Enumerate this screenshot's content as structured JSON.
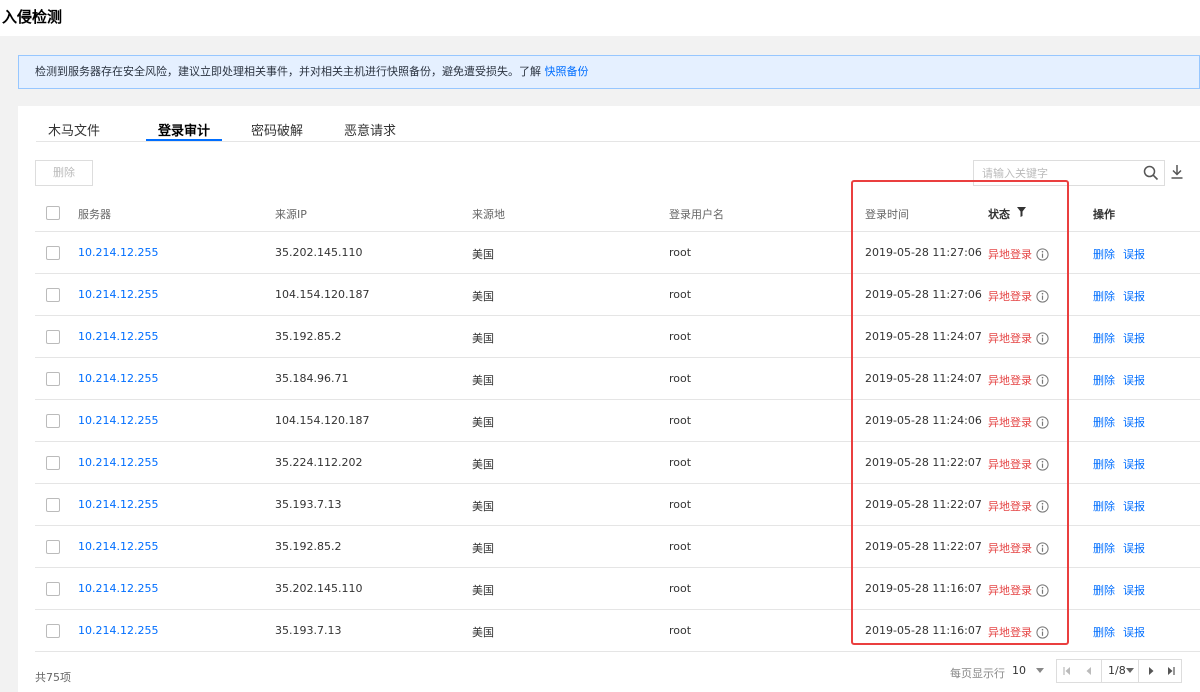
{
  "page": {
    "title": "入侵检测"
  },
  "notice": {
    "text": "检测到服务器存在安全风险，建议立即处理相关事件，并对相关主机进行快照备份，避免遭受损失。了解 ",
    "link": "快照备份"
  },
  "tabs": [
    {
      "label": "木马文件",
      "active": false
    },
    {
      "label": "登录审计",
      "active": true
    },
    {
      "label": "密码破解",
      "active": false
    },
    {
      "label": "恶意请求",
      "active": false
    }
  ],
  "toolbar": {
    "delete_label": "删除",
    "search_placeholder": "请输入关键字"
  },
  "table": {
    "columns": {
      "server": "服务器",
      "source_ip": "来源IP",
      "source_location": "来源地",
      "login_user": "登录用户名",
      "login_time": "登录时间",
      "status": "状态",
      "actions": "操作"
    },
    "rows": [
      {
        "server": "10.214.12.255",
        "ip": "35.202.145.110",
        "location": "美国",
        "user": "root",
        "time": "2019-05-28 11:27:06",
        "status": "异地登录",
        "delete": "删除",
        "report": "误报"
      },
      {
        "server": "10.214.12.255",
        "ip": "104.154.120.187",
        "location": "美国",
        "user": "root",
        "time": "2019-05-28 11:27:06",
        "status": "异地登录",
        "delete": "删除",
        "report": "误报"
      },
      {
        "server": "10.214.12.255",
        "ip": "35.192.85.2",
        "location": "美国",
        "user": "root",
        "time": "2019-05-28 11:24:07",
        "status": "异地登录",
        "delete": "删除",
        "report": "误报"
      },
      {
        "server": "10.214.12.255",
        "ip": "35.184.96.71",
        "location": "美国",
        "user": "root",
        "time": "2019-05-28 11:24:07",
        "status": "异地登录",
        "delete": "删除",
        "report": "误报"
      },
      {
        "server": "10.214.12.255",
        "ip": "104.154.120.187",
        "location": "美国",
        "user": "root",
        "time": "2019-05-28 11:24:06",
        "status": "异地登录",
        "delete": "删除",
        "report": "误报"
      },
      {
        "server": "10.214.12.255",
        "ip": "35.224.112.202",
        "location": "美国",
        "user": "root",
        "time": "2019-05-28 11:22:07",
        "status": "异地登录",
        "delete": "删除",
        "report": "误报"
      },
      {
        "server": "10.214.12.255",
        "ip": "35.193.7.13",
        "location": "美国",
        "user": "root",
        "time": "2019-05-28 11:22:07",
        "status": "异地登录",
        "delete": "删除",
        "report": "误报"
      },
      {
        "server": "10.214.12.255",
        "ip": "35.192.85.2",
        "location": "美国",
        "user": "root",
        "time": "2019-05-28 11:22:07",
        "status": "异地登录",
        "delete": "删除",
        "report": "误报"
      },
      {
        "server": "10.214.12.255",
        "ip": "35.202.145.110",
        "location": "美国",
        "user": "root",
        "time": "2019-05-28 11:16:07",
        "status": "异地登录",
        "delete": "删除",
        "report": "误报"
      },
      {
        "server": "10.214.12.255",
        "ip": "35.193.7.13",
        "location": "美国",
        "user": "root",
        "time": "2019-05-28 11:16:07",
        "status": "异地登录",
        "delete": "删除",
        "report": "误报"
      }
    ]
  },
  "footer": {
    "total": "共75项",
    "page_size_label": "每页显示行",
    "page_size": "10",
    "current_page": "1/8"
  },
  "colors": {
    "accent": "#006eff",
    "status_red": "#e54545",
    "highlight": "#ea3f3f"
  },
  "icons": {
    "search": "search-icon",
    "download": "download-icon",
    "filter": "filter-icon",
    "info": "info-icon"
  }
}
